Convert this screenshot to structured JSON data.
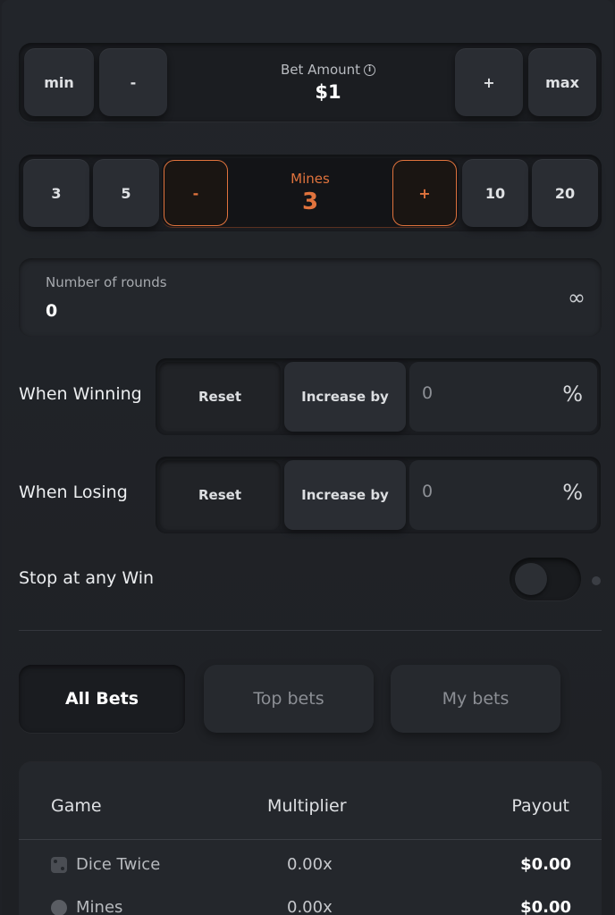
{
  "bet": {
    "min_label": "min",
    "minus_label": "-",
    "title": "Bet Amount",
    "info_glyph": "i",
    "value": "$1",
    "plus_label": "+",
    "max_label": "max"
  },
  "mines": {
    "preset_a": "3",
    "preset_b": "5",
    "minus_label": "-",
    "title": "Mines",
    "value": "3",
    "plus_label": "+",
    "preset_c": "10",
    "preset_d": "20",
    "accent_color": "#e0733d"
  },
  "rounds": {
    "label": "Number of rounds",
    "value": "0",
    "infinity_glyph": "∞"
  },
  "when_winning": {
    "label": "When Winning",
    "reset_label": "Reset",
    "increase_label": "Increase by",
    "value": "0",
    "unit": "%"
  },
  "when_losing": {
    "label": "When Losing",
    "reset_label": "Reset",
    "increase_label": "Increase by",
    "value": "0",
    "unit": "%"
  },
  "stop_win": {
    "label": "Stop at any Win",
    "toggled": false
  },
  "tabs": [
    {
      "label": "All Bets",
      "active": true
    },
    {
      "label": "Top bets",
      "active": false
    },
    {
      "label": "My bets",
      "active": false
    }
  ],
  "table": {
    "headers": {
      "game": "Game",
      "multiplier": "Multiplier",
      "payout": "Payout"
    },
    "rows": [
      {
        "game": "Dice Twice",
        "icon": "dice-icon",
        "multiplier": "0.00x",
        "payout": "$0.00"
      },
      {
        "game": "Mines",
        "icon": "mine-icon",
        "multiplier": "0.00x",
        "payout": "$0.00"
      }
    ]
  }
}
